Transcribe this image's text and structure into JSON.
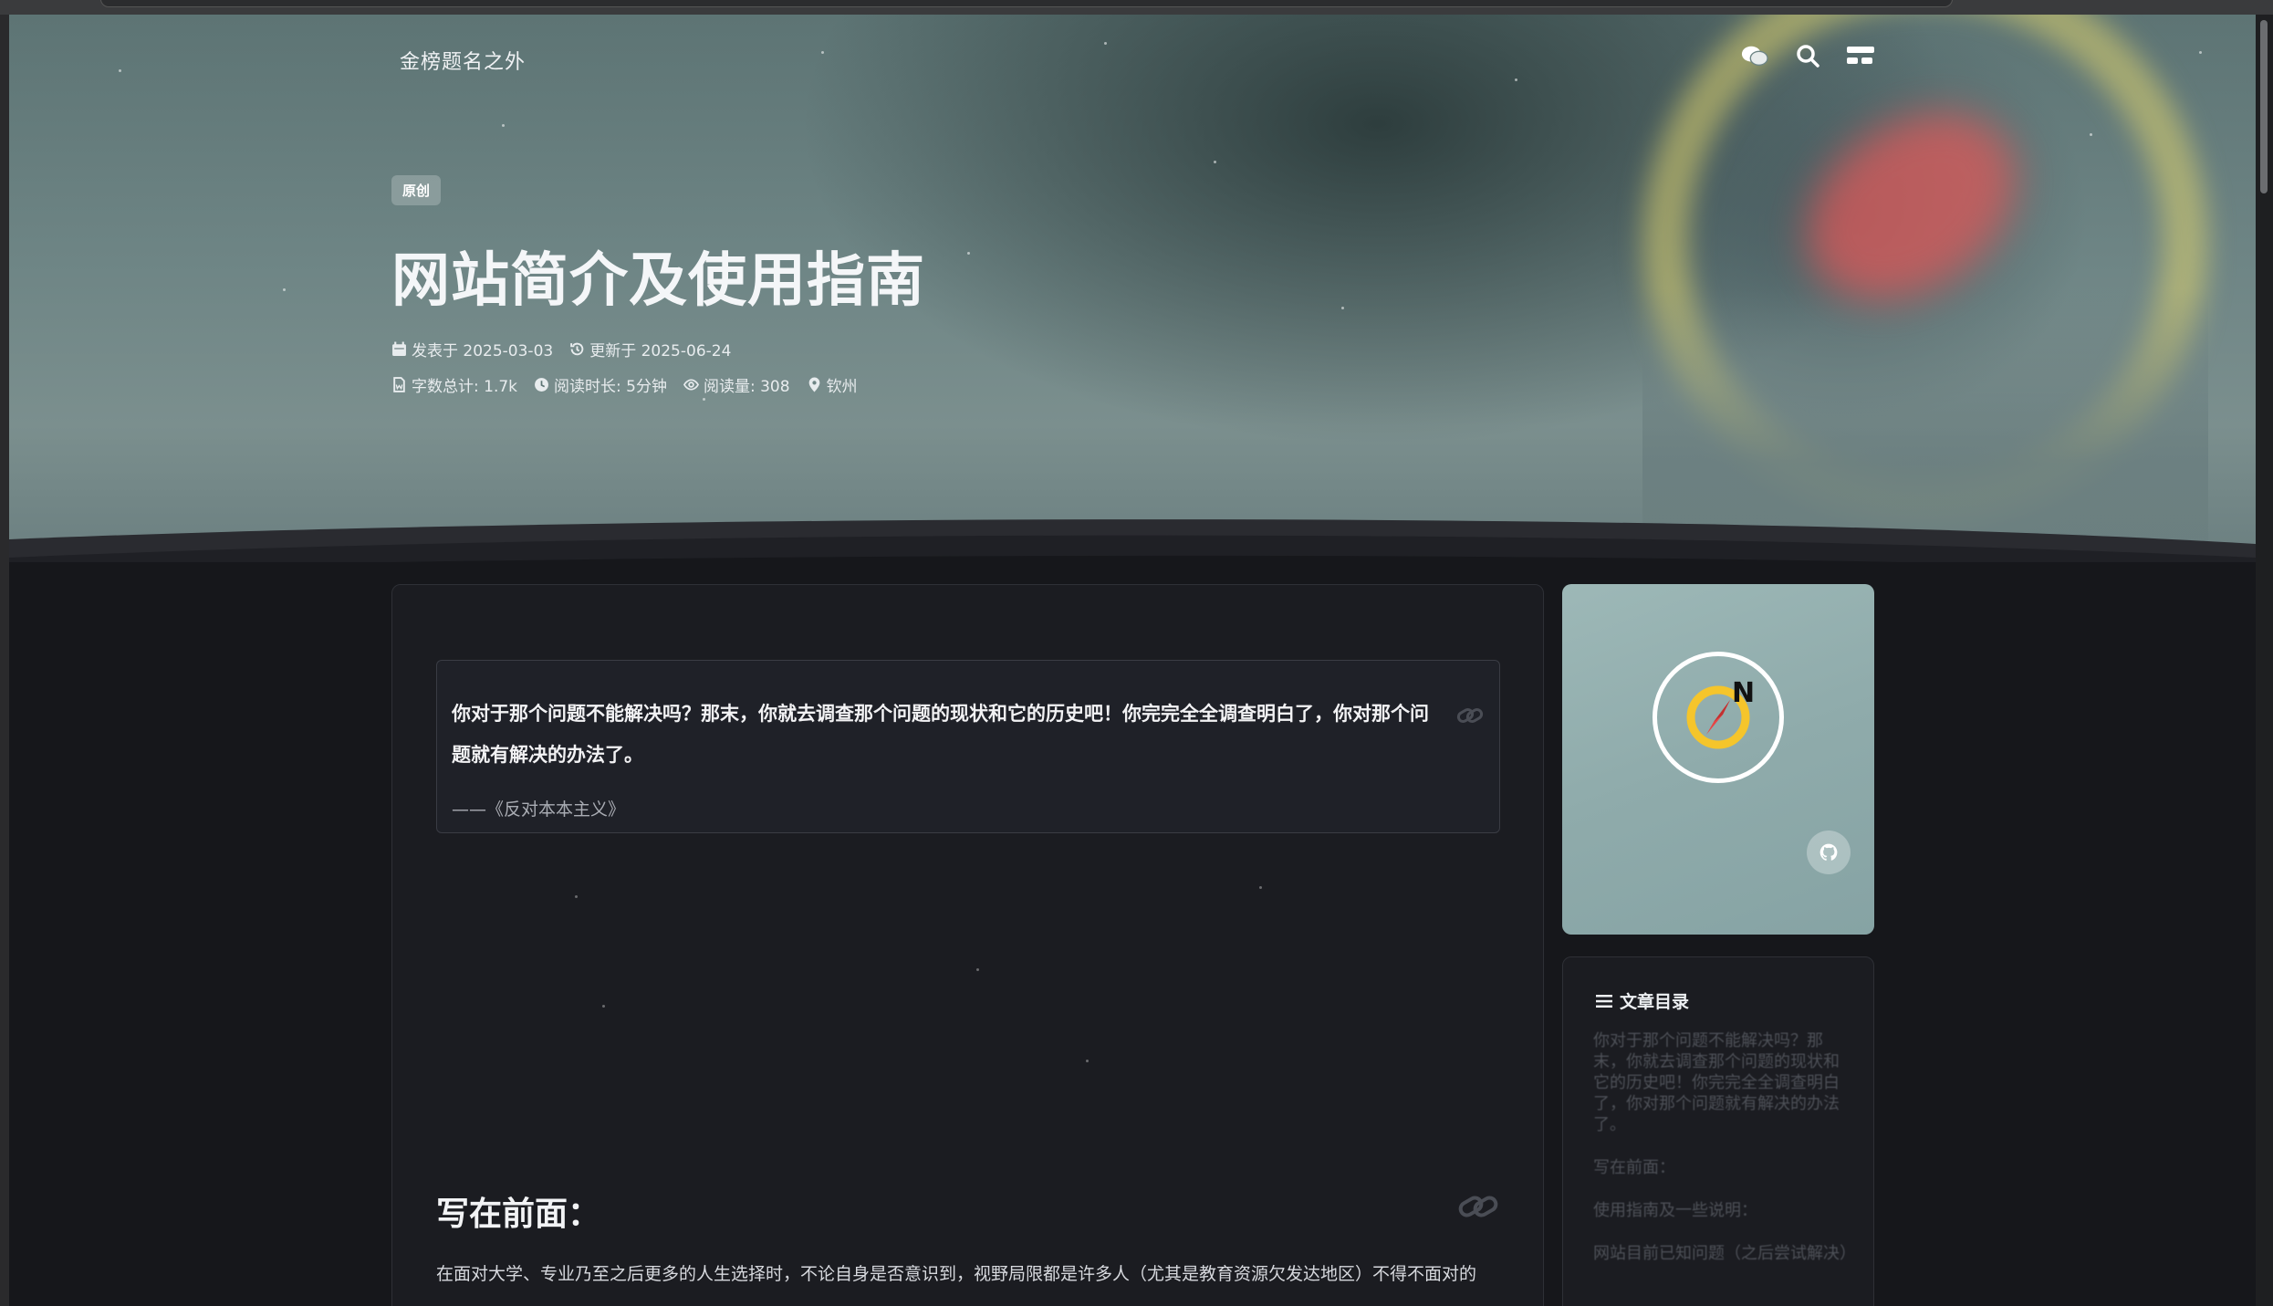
{
  "site": {
    "name": "金榜题名之外"
  },
  "nav": {
    "icons": [
      "wechat-icon",
      "search-icon",
      "menu-icon"
    ]
  },
  "post": {
    "badge": "原创",
    "title": "网站简介及使用指南",
    "published": "发表于 2025-03-03",
    "updated": "更新于 2025-06-24",
    "word_count": "字数总计: 1.7k",
    "read_time": "阅读时长: 5分钟",
    "views": "阅读量: 308",
    "location": "钦州"
  },
  "quote": {
    "text": "你对于那个问题不能解决吗？那末，你就去调查那个问题的现状和它的历史吧！你完完全全调查明白了，你对那个问题就有解决的办法了。",
    "source": "——《反对本本主义》"
  },
  "section": {
    "heading": "写在前面：",
    "paragraph": "在面对大学、专业乃至之后更多的人生选择时，不论自身是否意识到，视野局限都是许多人（尤其是教育资源欠发达地区）不得不面对的"
  },
  "toc": {
    "title": "文章目录",
    "items": [
      "你对于那个问题不能解决吗？那末，你就去调查那个问题的现状和它的历史吧！你完完全全调查明白了，你对那个问题就有解决的办法了。",
      "写在前面：",
      "使用指南及一些说明：",
      "网站目前已知问题（之后尝试解决）"
    ]
  },
  "colors": {
    "accent_yellow": "#f5c52b",
    "accent_red": "#e64545",
    "card_bg": "#1b1c21"
  }
}
